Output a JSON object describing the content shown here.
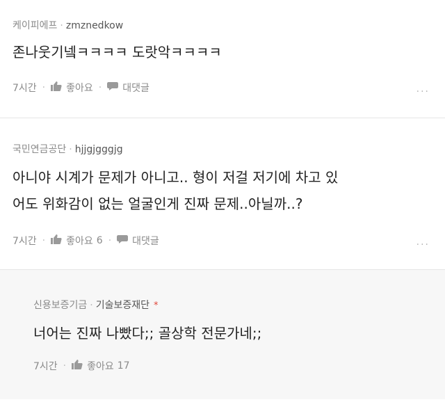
{
  "comments": [
    {
      "nickname": "케이피에프",
      "user_id": "zmznedkow",
      "text_lines": [
        "존나웃기넼ㅋㅋㅋㅋ 도랏악ㅋㅋㅋㅋ"
      ],
      "time": "7시간",
      "like_label": "좋아요",
      "like_count": "",
      "reply_label": "대댓글",
      "more": "..."
    },
    {
      "nickname": "국민연금공단",
      "user_id": "hjjgjgggjg",
      "text_lines": [
        "아니야 시계가 문제가 아니고.. 형이 저걸 저기에 차고 있",
        "어도 위화감이 없는 얼굴인게 진짜 문제..아닐까..?"
      ],
      "time": "7시간",
      "like_label": "좋아요",
      "like_count": "6",
      "reply_label": "대댓글",
      "more": "..."
    }
  ],
  "reply": {
    "nickname": "신용보증기금",
    "user_id": "기술보증재단",
    "badge": "*",
    "text_lines": [
      "너어는 진짜 나빴다;; 골상학 전문가네;;"
    ],
    "time": "7시간",
    "like_label": "좋아요",
    "like_count": "17"
  },
  "colors": {
    "meta": "#8a8a8a",
    "badge": "#e0463a",
    "reply_bg": "#f7f7f7"
  }
}
